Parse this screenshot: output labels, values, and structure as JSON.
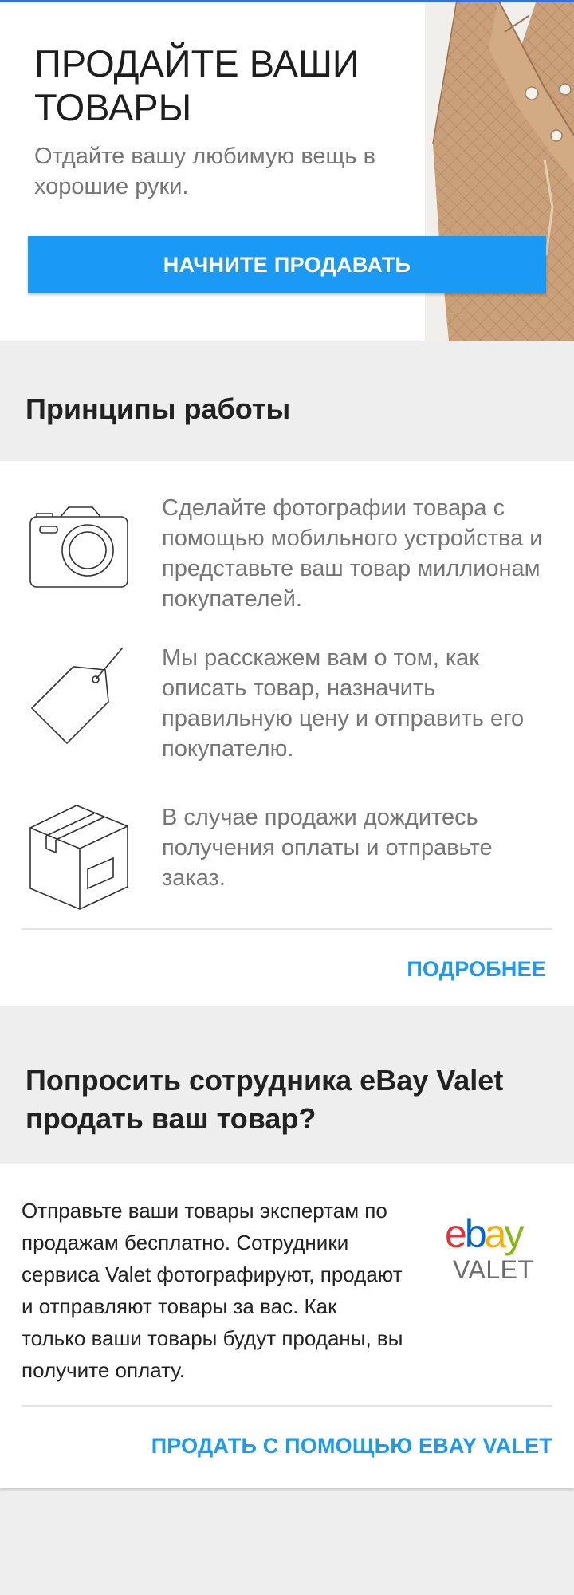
{
  "hero": {
    "title": "ПРОДАЙТЕ ВАШИ ТОВАРЫ",
    "subtitle": "Отдайте вашу любимую вещь в хорошие руки.",
    "button_label": "НАЧНИТЕ ПРОДАВАТЬ",
    "accent_color": "#1a9af5"
  },
  "how_it_works": {
    "title": "Принципы работы",
    "steps": [
      {
        "icon": "camera-icon",
        "text": "Сделайте фотографии товара с помощью мобильного устройства и представьте ваш товар миллионам покупателей."
      },
      {
        "icon": "price-tag-icon",
        "text": "Мы расскажем вам о том, как описать товар, назначить правильную цену и отправить его покупателю."
      },
      {
        "icon": "package-box-icon",
        "text": "В случае продажи дождитесь получения оплаты и отправьте заказ."
      }
    ],
    "more_link": "ПОДРОБНЕЕ"
  },
  "valet": {
    "title": "Попросить сотрудника eBay Valet продать ваш товар?",
    "description": "Отправьте ваши товары экспертам по продажам бесплатно. Сотрудники сервиса Valet фотографируют, продают и отправляют товары за вас. Как только ваши товары будут проданы, вы получите оплату.",
    "logo": {
      "brand_letters": [
        "e",
        "b",
        "a",
        "y"
      ],
      "brand_colors": [
        "#e53238",
        "#0064d2",
        "#f5af02",
        "#86b817"
      ],
      "sub": "VALET"
    },
    "cta_link": "ПРОДАТЬ С ПОМОЩЬЮ EBAY VALET"
  }
}
